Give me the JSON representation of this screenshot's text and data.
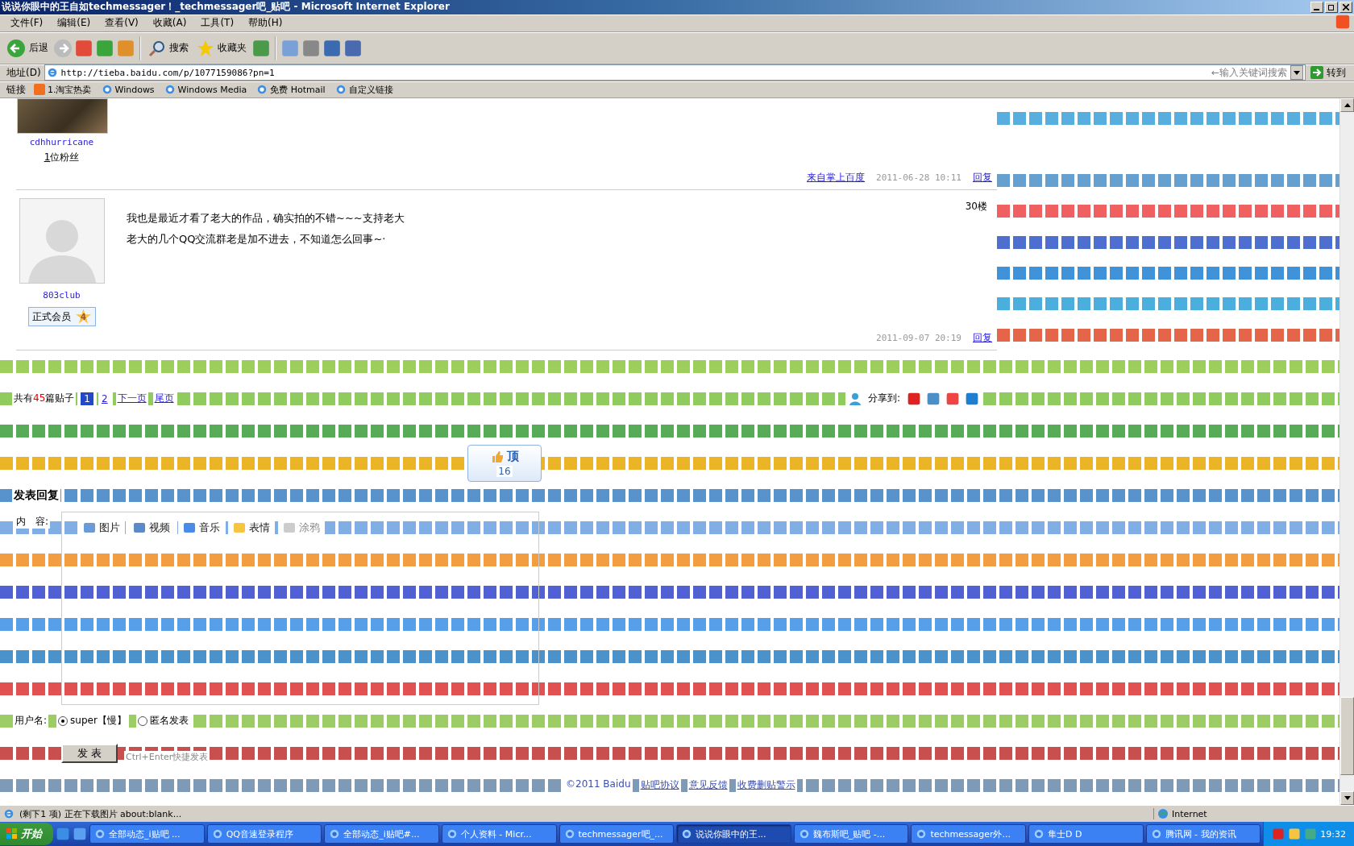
{
  "window": {
    "title": "说说你眼中的王自如techmessager！_techmessager吧_贴吧 - Microsoft Internet Explorer"
  },
  "menu": [
    "文件(F)",
    "编辑(E)",
    "查看(V)",
    "收藏(A)",
    "工具(T)",
    "帮助(H)"
  ],
  "toolbar": {
    "back": "后退",
    "search": "搜索",
    "favorites": "收藏夹"
  },
  "address_bar": {
    "label": "地址(D)",
    "url": "http://tieba.baidu.com/p/1077159086?pn=1",
    "search_hint": "←输入关键词搜索",
    "go": "转到"
  },
  "links_bar": {
    "label": "链接",
    "items": [
      "1.淘宝热卖",
      "Windows",
      "Windows Media",
      "免费 Hotmail",
      "自定义链接"
    ]
  },
  "previous_post": {
    "author": "cdhhurricane",
    "fans_count": "1",
    "fans_label": "位粉丝",
    "source": "来自掌上百度",
    "time": "2011-06-28 10:11",
    "reply": "回复"
  },
  "post": {
    "floor": "30楼",
    "lines": [
      "我也是最近才看了老大的作品，确实拍的不错~~~支持老大",
      "老大的几个QQ交流群老是加不进去，不知道怎么回事~·"
    ],
    "author": "803club",
    "badge": {
      "label": "正式会员",
      "level": "4"
    },
    "time": "2011-09-07 20:19",
    "reply": "回复"
  },
  "pagination": {
    "prefix": "共有",
    "count": "45",
    "suffix": "篇贴子",
    "pages": [
      {
        "label": "1",
        "selected": true
      },
      {
        "label": "2",
        "selected": false
      }
    ],
    "next": "下一页",
    "last": "尾页"
  },
  "share": {
    "label": "分享到:"
  },
  "top_button": {
    "label": "顶",
    "count": "16"
  },
  "reply_form": {
    "heading": "发表回复",
    "content_label": "内　容:",
    "tools": [
      {
        "label": "图片",
        "disabled": false
      },
      {
        "label": "视频",
        "disabled": false
      },
      {
        "label": "音乐",
        "disabled": false
      },
      {
        "label": "表情",
        "disabled": false
      },
      {
        "label": "涂鸦",
        "disabled": true
      }
    ],
    "username_label": "用户名:",
    "identities": [
      {
        "label": "super【慢】",
        "selected": true
      },
      {
        "label": "匿名发表",
        "selected": false
      }
    ],
    "submit": "发 表",
    "hint": "Ctrl+Enter快捷发表"
  },
  "footer": {
    "copyright": "©2011 Baidu",
    "links": [
      "贴吧协议",
      "意见反馈",
      "收费删贴警示"
    ]
  },
  "status_bar": {
    "text": "(剩下1 项) 正在下载图片 about:blank...",
    "zone": "Internet"
  },
  "taskbar": {
    "start": "开始",
    "tasks": [
      {
        "label": "全部动态_i贴吧 ...",
        "selected": false
      },
      {
        "label": "QQ音速登录程序",
        "selected": false
      },
      {
        "label": "全部动态_i贴吧#...",
        "selected": false
      },
      {
        "label": "个人资料 - Micr...",
        "selected": false
      },
      {
        "label": "techmessager吧_...",
        "selected": false
      },
      {
        "label": "说说你眼中的王...",
        "selected": true
      },
      {
        "label": "魏布斯吧_贴吧 -...",
        "selected": false
      },
      {
        "label": "techmessager外...",
        "selected": false
      },
      {
        "label": "隼士D D",
        "selected": false
      },
      {
        "label": "腾讯网 - 我的资讯",
        "selected": false
      }
    ],
    "clock": "19:32"
  }
}
